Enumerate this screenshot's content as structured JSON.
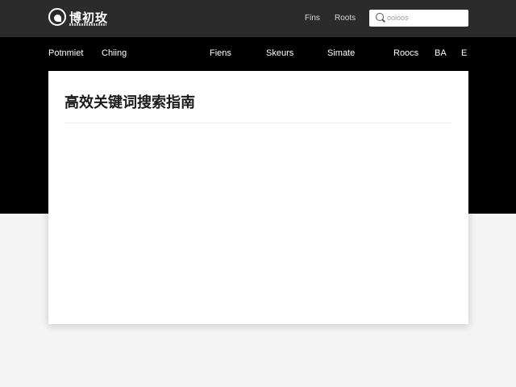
{
  "header": {
    "logo_text": "博初玫",
    "links": [
      "Fins",
      "Roots"
    ],
    "search": {
      "placeholder": "ooioos",
      "value": ""
    }
  },
  "nav": {
    "items": [
      "Potnmiet",
      "Chiing",
      "Fiens",
      "Skeurs",
      "Simate",
      "Roocs",
      "BA",
      "E"
    ]
  },
  "article": {
    "title": "高效关键词搜索指南"
  },
  "colors": {
    "topbar": "#2b2b2b",
    "nav_band": "#000000",
    "page_bg": "#f4f4f4",
    "card_bg": "#ffffff"
  }
}
